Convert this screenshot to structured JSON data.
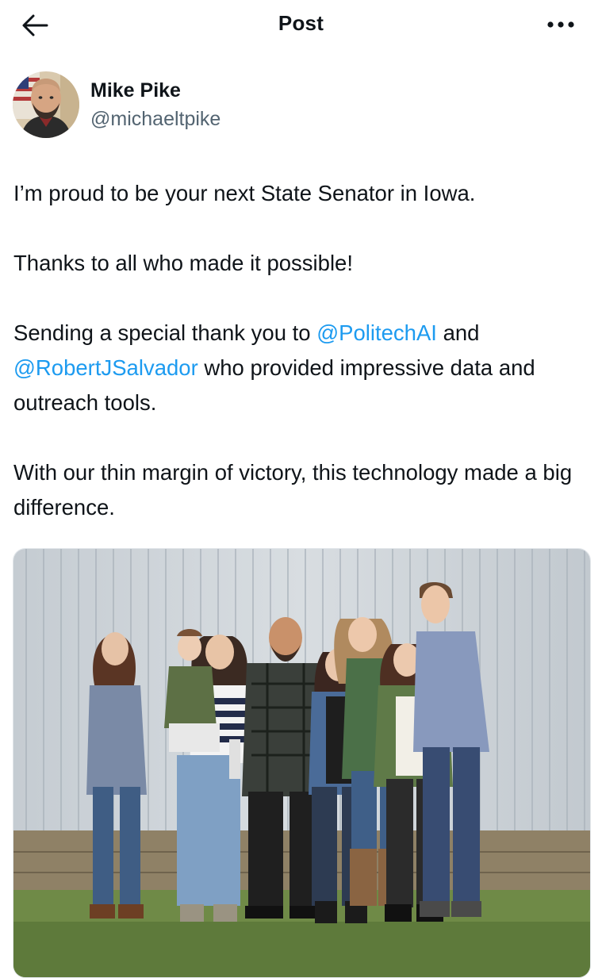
{
  "header": {
    "title": "Post",
    "back_icon": "arrow-left-icon",
    "more_icon": "more-dots-icon"
  },
  "post": {
    "author": {
      "name": "Mike Pike",
      "handle": "@michaeltpike"
    },
    "paragraphs": {
      "p1": "I’m proud to be your next State Senator in Iowa.",
      "p2": "Thanks to all who made it possible!",
      "p3_a": "Sending a special thank you to ",
      "p3_mention1": "@PolitechAI",
      "p3_b": " and ",
      "p3_mention2": "@RobertJSalvador",
      "p3_c": " who provided impressive data and outreach tools.",
      "p4": "With our thin margin of victory, this technology made a big difference."
    },
    "media": {
      "type": "photo"
    }
  },
  "colors": {
    "text": "#0f1419",
    "secondary": "#536471",
    "link": "#1d9bf0"
  }
}
